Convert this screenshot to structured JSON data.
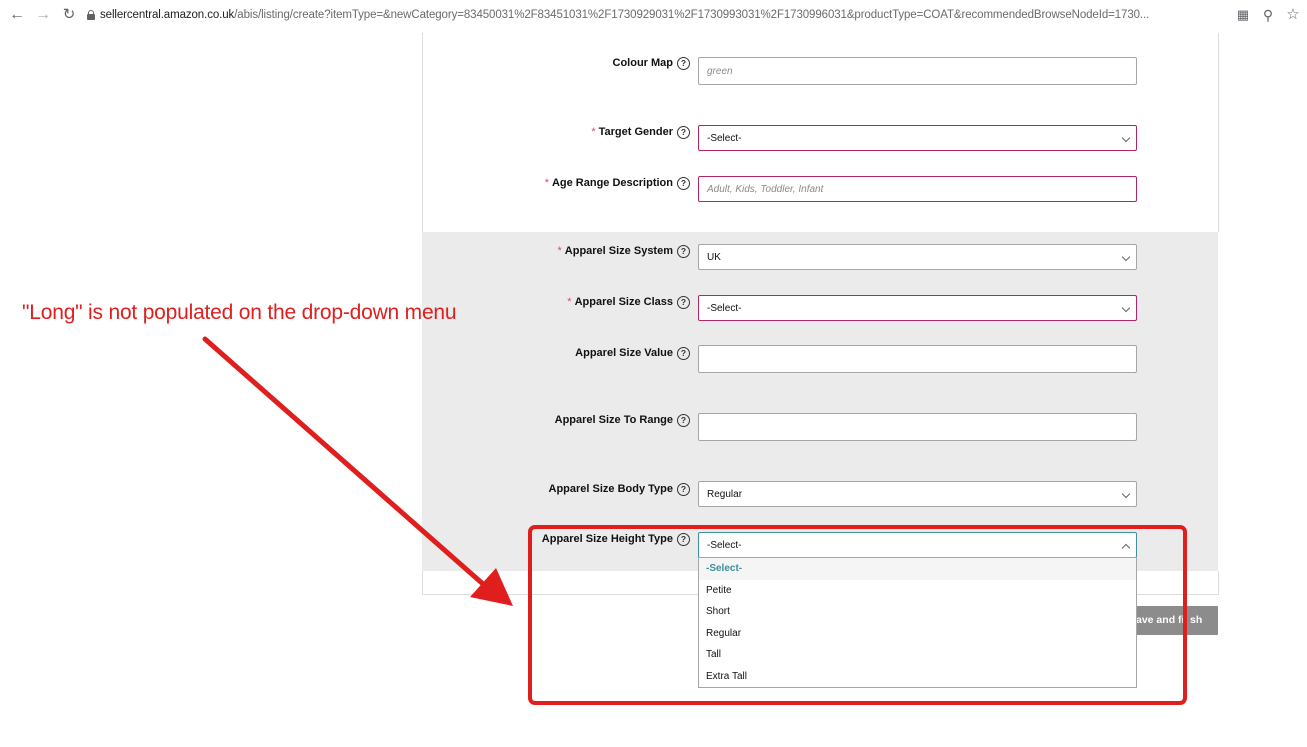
{
  "browser": {
    "url_host": "sellercentral.amazon.co.uk",
    "url_path": "/abis/listing/create?itemType=&newCategory=83450031%2F83451031%2F1730929031%2F1730993031%2F1730996031&productType=COAT&recommendedBrowseNodeId=1730..."
  },
  "form": {
    "colour_map": {
      "label": "Colour Map",
      "value": "green",
      "required": false
    },
    "target_gender": {
      "label": "Target Gender",
      "value": "-Select-",
      "required": true
    },
    "age_range": {
      "label": "Age Range Description",
      "placeholder": "Adult, Kids, Toddler, Infant",
      "required": true
    },
    "size_system": {
      "label": "Apparel Size System",
      "value": "UK",
      "required": true
    },
    "size_class": {
      "label": "Apparel Size Class",
      "value": "-Select-",
      "required": true
    },
    "size_value": {
      "label": "Apparel Size Value",
      "value": ""
    },
    "size_to_range": {
      "label": "Apparel Size To Range",
      "value": ""
    },
    "body_type": {
      "label": "Apparel Size Body Type",
      "value": "Regular"
    },
    "height_type": {
      "label": "Apparel Size Height Type",
      "value": "-Select-",
      "options": [
        "-Select-",
        "Petite",
        "Short",
        "Regular",
        "Tall",
        "Extra Tall"
      ]
    },
    "required_marker": "*",
    "help_glyph": "?"
  },
  "save_button": {
    "label_fragment": "ave and fi",
    "label_tail": "sh"
  },
  "annotation": {
    "text": "\"Long\" is not populated on the drop-down menu",
    "color": "#e01e1e"
  },
  "colors": {
    "error_border": "#b12466",
    "focus_border": "#3d8f9c",
    "grey_section": "#ebebeb"
  }
}
